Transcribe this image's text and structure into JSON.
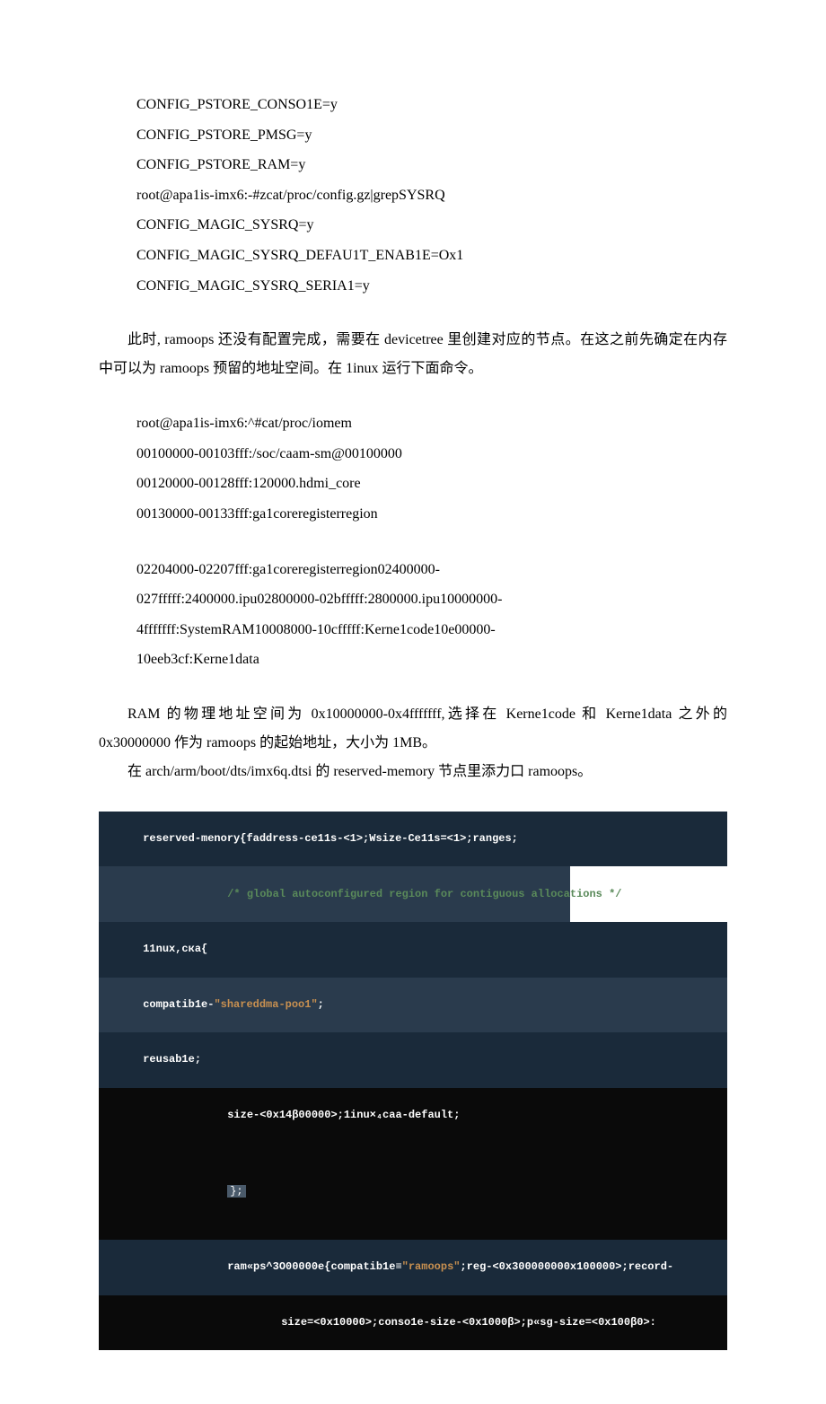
{
  "block1": {
    "l1": "CONFIG_PSTORE_CONSO1E=y",
    "l2": "CONFIG_PSTORE_PMSG=y",
    "l3": "CONFIG_PSTORE_RAM=y",
    "l4": "root@apa1is-imx6:-#zcat/proc/config.gz|grepSYSRQ",
    "l5": "CONFIG_MAGIC_SYSRQ=y",
    "l6": "CONFIG_MAGIC_SYSRQ_DEFAU1T_ENAB1E=Ox1",
    "l7": "CONFIG_MAGIC_SYSRQ_SERIA1=y"
  },
  "para1": "此时, ramoops 还没有配置完成，需要在 devicetree 里创建对应的节点。在这之前先确定在内存中可以为 ramoops 预留的地址空间。在 1inux 运行下面命令。",
  "block2": {
    "l1": "root@apa1is-imx6:^#cat/proc/iomem",
    "l2": "00100000-00103fff:/soc/caam-sm@00100000",
    "l3": "00120000-00128fff:120000.hdmi_core",
    "l4": "00130000-00133fff:ga1coreregisterregion"
  },
  "block3": {
    "l1": "02204000-02207fff:ga1coreregisterregion02400000-",
    "l2": "027fffff:2400000.ipu02800000-02bfffff:2800000.ipu10000000-",
    "l3": "4fffffff:SystemRAM10008000-10cfffff:Kerne1code10e00000-",
    "l4": "10eeb3cf:Kerne1data"
  },
  "para2": "RAM 的物理地址空间为 0x10000000-0x4fffffff,选择在 Kerne1code 和 Kerne1data 之外的 0x30000000 作为 ramoops 的起始地址，大小为 1MB。",
  "para3": "在 arch/arm/boot/dts/imx6q.dtsi 的 reserved-memory 节点里添力口 ramoops。",
  "code": {
    "l1_a": "reserved-menory{faddress-ce11s-<1>;Wsize-Ce11s=<1>;ranges;",
    "l2_comment": "/* global autoconfigured region for contiguous allocations */",
    "l3": "11nux,cка{",
    "l4_a": "compatib1e-",
    "l4_b": "\"shareddma-poo1\"",
    "l4_c": ";",
    "l5": "reusab1e;",
    "l6": "size-<0x14β00000>;1inu×₄caa-default;",
    "l7": "};",
    "l8_a": "ram«ps^3O00000e{compatib1e≡",
    "l8_b": "\"ramoops\"",
    "l8_c": ";reg-<0x300000000x100000>;record-",
    "l9": "size=<0x10000>;conso1e-size-<0x1000β>;p«sg-size=<0x100β0>:"
  }
}
